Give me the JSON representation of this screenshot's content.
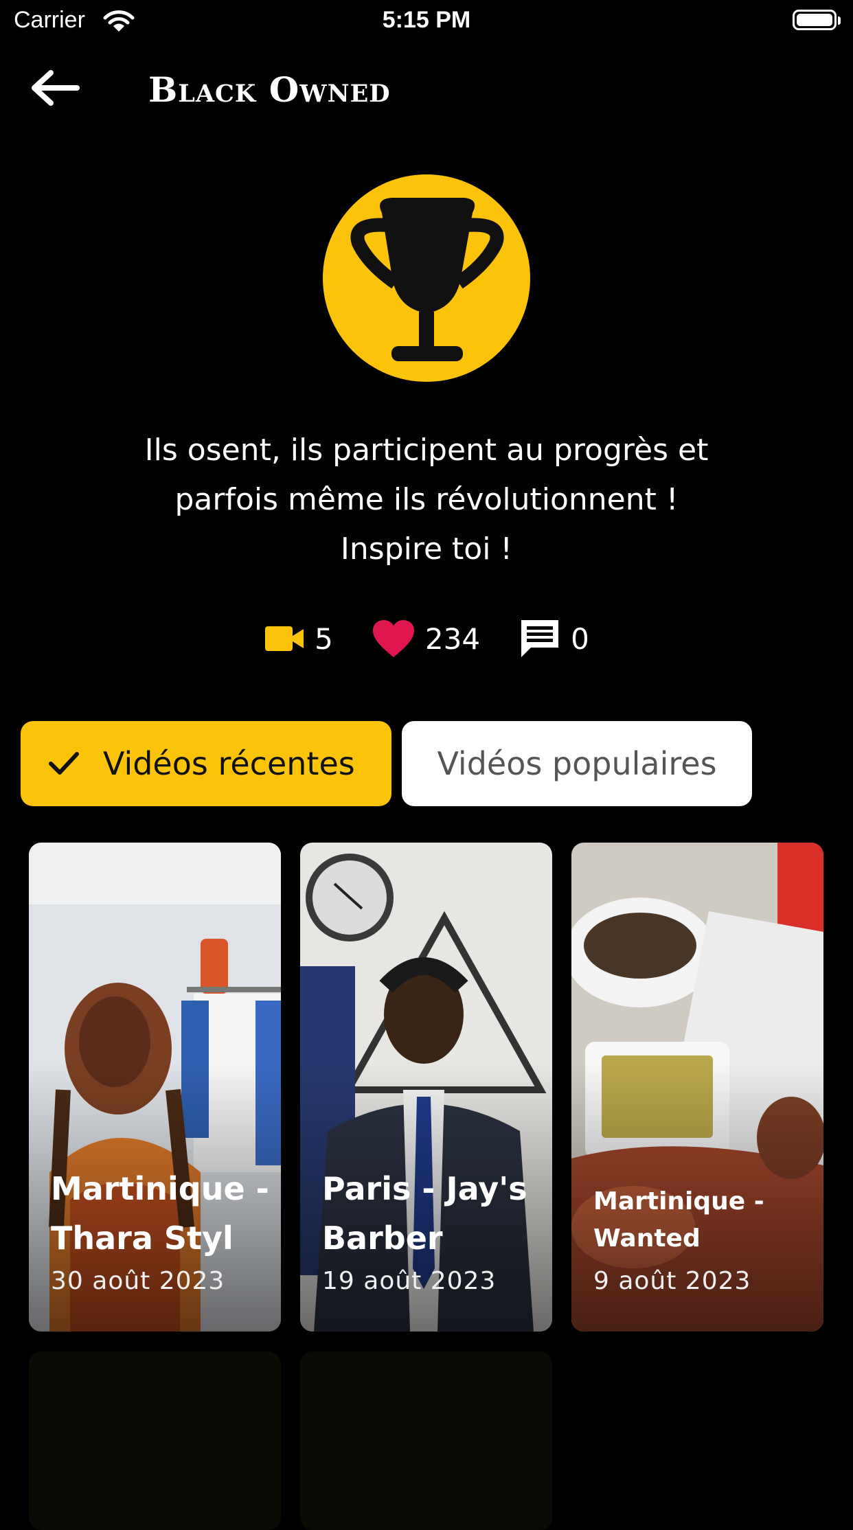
{
  "status_bar": {
    "carrier": "Carrier",
    "time": "5:15 PM"
  },
  "header": {
    "title": "Black Owned",
    "back_icon": "arrow-left-icon"
  },
  "category": {
    "icon": "trophy-icon",
    "accent_color": "#fbc30a",
    "tagline_lines": [
      "Ils osent, ils participent au progrès et",
      "parfois même ils révolutionnent !",
      "Inspire toi !"
    ]
  },
  "stats": {
    "videos": {
      "icon": "video-camera-icon",
      "value": "5",
      "color": "#fbc30a"
    },
    "likes": {
      "icon": "heart-icon",
      "value": "234",
      "color": "#e0174f"
    },
    "comments": {
      "icon": "comment-icon",
      "value": "0",
      "color": "#ffffff"
    }
  },
  "tabs": [
    {
      "label": "Vidéos récentes",
      "selected": true,
      "icon": "check-icon"
    },
    {
      "label": "Vidéos populaires",
      "selected": false
    }
  ],
  "videos": [
    {
      "title": "Martinique - Thara Styl",
      "date": "30 août 2023"
    },
    {
      "title": "Paris - Jay's Barber",
      "date": "19 août 2023"
    },
    {
      "title": "Martinique - Wanted",
      "date": "9 août 2023"
    }
  ]
}
